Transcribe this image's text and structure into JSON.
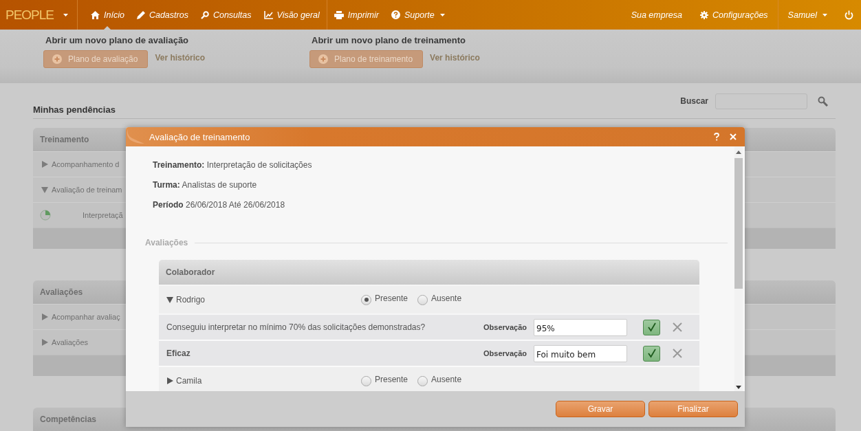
{
  "navbar": {
    "brand": "PEOPLE",
    "items": [
      {
        "label": "Início",
        "selected": true,
        "dropdown": false
      },
      {
        "label": "Cadastros",
        "selected": false,
        "dropdown": false
      },
      {
        "label": "Consultas",
        "selected": false,
        "dropdown": false
      },
      {
        "label": "Visão geral",
        "selected": false,
        "dropdown": false
      },
      {
        "label": "Imprimir",
        "selected": false,
        "dropdown": false
      },
      {
        "label": "Suporte",
        "selected": false,
        "dropdown": true
      }
    ],
    "right_items": [
      {
        "label": "Sua empresa"
      },
      {
        "label": "Configurações"
      }
    ],
    "user": "Samuel"
  },
  "shortcuts": [
    {
      "heading": "Abrir um novo plano de avaliação",
      "button": "Plano de avaliação",
      "link": "Ver histórico"
    },
    {
      "heading": "Abrir um novo plano de treinamento",
      "button": "Plano de treinamento",
      "link": "Ver histórico"
    }
  ],
  "pending": {
    "title": "Minhas pendências",
    "search_label": "Buscar",
    "panels": [
      {
        "title": "Treinamento",
        "rows": [
          {
            "label": "Acompanhamento d",
            "expanded": false
          },
          {
            "label": "Avaliação de treinam",
            "expanded": true,
            "children": [
              {
                "label": "Interpretaçã"
              }
            ]
          }
        ]
      },
      {
        "title": "Avaliações",
        "rows": [
          {
            "label": "Acompanhar avaliaç",
            "expanded": false
          },
          {
            "label": "Avaliações",
            "expanded": false
          }
        ]
      },
      {
        "title": "Competências"
      }
    ]
  },
  "dialog": {
    "title": "Avaliação de treinamento",
    "fields": [
      {
        "label": "Treinamento:",
        "value": "Interpretação de solicitações"
      },
      {
        "label": "Turma:",
        "value": "Analistas de suporte"
      },
      {
        "label": "Período",
        "value": "26/06/2018 Até 26/06/2018"
      }
    ],
    "section": "Avaliações",
    "table": {
      "column": "Colaborador",
      "rows": [
        {
          "name": "Rodrigo",
          "expanded": true,
          "attendance": [
            {
              "label": "Presente",
              "selected": true
            },
            {
              "label": "Ausente",
              "selected": false
            }
          ],
          "criteria": [
            {
              "kind": "question",
              "text": "Conseguiu interpretar no mínimo 70% das solicitações demonstradas?",
              "observation_label": "Observação",
              "observation": "95%",
              "approved": true
            },
            {
              "kind": "result",
              "text": "Eficaz",
              "observation_label": "Observação",
              "observation": "Foi muito bem",
              "approved": true
            }
          ]
        },
        {
          "name": "Camila",
          "expanded": false,
          "attendance": [
            {
              "label": "Presente",
              "selected": false
            },
            {
              "label": "Ausente",
              "selected": false
            }
          ]
        }
      ]
    },
    "buttons": [
      "Gravar",
      "Finalizar"
    ]
  }
}
